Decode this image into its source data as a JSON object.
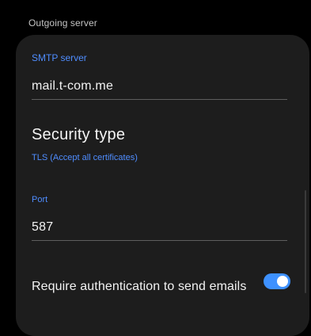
{
  "section": {
    "header": "Outgoing server"
  },
  "smtp": {
    "label": "SMTP server",
    "value": "mail.t-com.me"
  },
  "security": {
    "title": "Security type",
    "value": "TLS (Accept all certificates)"
  },
  "port": {
    "label": "Port",
    "value": "587"
  },
  "auth": {
    "label": "Require authentication to send emails",
    "enabled": true
  },
  "colors": {
    "accent": "#4f8dff",
    "toggle_on": "#3e91ff",
    "card_bg": "#1d1d1d",
    "page_bg": "#000000"
  }
}
